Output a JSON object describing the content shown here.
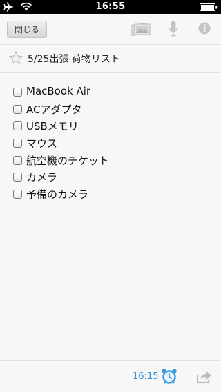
{
  "status_bar": {
    "time": "16:55",
    "airplane_icon": "airplane-icon",
    "wifi_icon": "wifi-icon",
    "battery_icon": "battery-icon"
  },
  "toolbar": {
    "close_label": "閉じる",
    "photo_icon": "photo-icon",
    "mic_icon": "microphone-icon",
    "info_icon": "info-icon"
  },
  "note": {
    "title": "5/25出張 荷物リスト",
    "starred": false
  },
  "checklist": [
    {
      "label": "MacBook Air",
      "checked": false
    },
    {
      "label": "ACアダプタ",
      "checked": false
    },
    {
      "label": "USBメモリ",
      "checked": false
    },
    {
      "label": "マウス",
      "checked": false
    },
    {
      "label": "航空機のチケット",
      "checked": false
    },
    {
      "label": "カメラ",
      "checked": false
    },
    {
      "label": "予備のカメラ",
      "checked": false
    }
  ],
  "bottom_bar": {
    "reminder_time": "16:15",
    "alarm_icon": "alarm-clock-icon",
    "share_icon": "share-icon"
  },
  "colors": {
    "accent": "#2b8fd6",
    "status_bar": "#000000",
    "background": "#f7f7f5"
  }
}
